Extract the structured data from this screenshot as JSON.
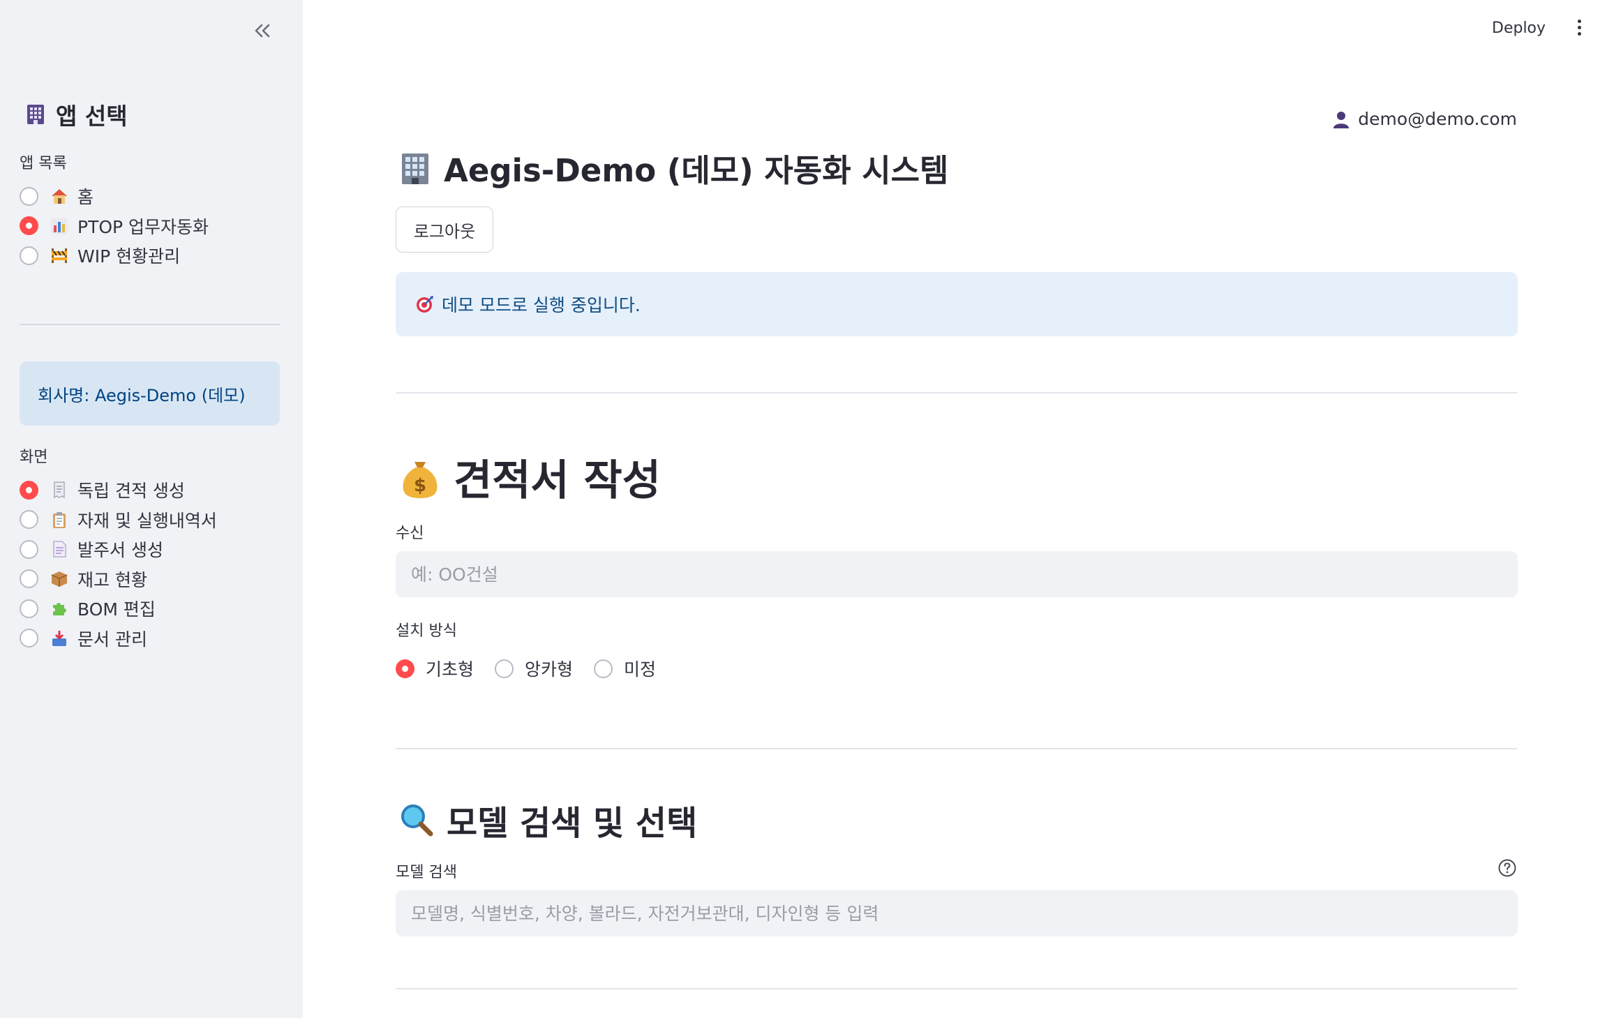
{
  "sidebar": {
    "title": "앱 선택",
    "app_list_label": "앱 목록",
    "apps": [
      {
        "label": "홈",
        "icon": "house-icon",
        "checked": false
      },
      {
        "label": "PTOP 업무자동화",
        "icon": "bar-chart-icon",
        "checked": true
      },
      {
        "label": "WIP 현황관리",
        "icon": "construction-icon",
        "checked": false
      }
    ],
    "company": "회사명: Aegis-Demo (데모)",
    "screen_label": "화면",
    "screens": [
      {
        "label": "독립 견적 생성",
        "icon": "receipt-icon",
        "checked": true
      },
      {
        "label": "자재 및 실행내역서",
        "icon": "clipboard-icon",
        "checked": false
      },
      {
        "label": "발주서 생성",
        "icon": "document-icon",
        "checked": false
      },
      {
        "label": "재고 현황",
        "icon": "package-icon",
        "checked": false
      },
      {
        "label": "BOM 편집",
        "icon": "puzzle-icon",
        "checked": false
      },
      {
        "label": "문서 관리",
        "icon": "inbox-tray-icon",
        "checked": false
      }
    ]
  },
  "header": {
    "deploy": "Deploy",
    "user_email": "demo@demo.com"
  },
  "main": {
    "title": "Aegis-Demo (데모) 자동화 시스템",
    "logout": "로그아웃",
    "info": "데모 모드로 실행 중입니다.",
    "quote_section": {
      "title": "견적서 작성",
      "recipient_label": "수신",
      "recipient_placeholder": "예: OO건설",
      "install_label": "설치 방식",
      "install_options": [
        {
          "label": "기초형",
          "checked": true
        },
        {
          "label": "앙카형",
          "checked": false
        },
        {
          "label": "미정",
          "checked": false
        }
      ]
    },
    "model_section": {
      "title": "모델 검색 및 선택",
      "search_label": "모델 검색",
      "search_placeholder": "모델명, 식별번호, 차양, 볼라드, 자전거보관대, 디자인형 등 입력"
    }
  },
  "colors": {
    "accent": "#ff4b4b",
    "sidebar_bg": "#f0f2f6",
    "info_bg": "#e6f0fb",
    "info_text": "#0f4c81"
  }
}
